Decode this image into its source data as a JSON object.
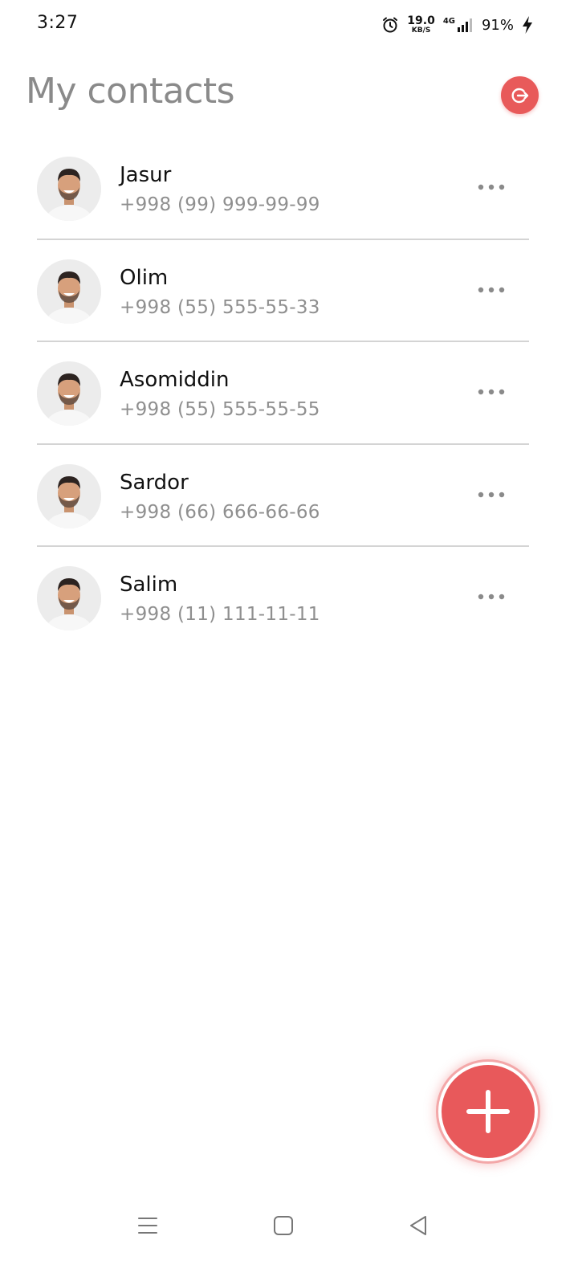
{
  "status_bar": {
    "time": "3:27",
    "net_speed_value": "19.0",
    "net_speed_unit": "KB/S",
    "network_type": "4G",
    "battery": "91%"
  },
  "header": {
    "title": "My contacts",
    "logout_icon": "logout-icon"
  },
  "contacts": [
    {
      "name": "Jasur",
      "phone": "+998 (99) 999-99-99"
    },
    {
      "name": "Olim",
      "phone": "+998 (55) 555-55-33"
    },
    {
      "name": "Asomiddin",
      "phone": "+998 (55) 555-55-55"
    },
    {
      "name": "Sardor",
      "phone": "+998 (66) 666-66-66"
    },
    {
      "name": "Salim",
      "phone": "+998 (11) 111-11-11"
    }
  ],
  "fab": {
    "icon": "plus-icon"
  },
  "nav": {
    "menu_icon": "menu-icon",
    "home_icon": "home-icon",
    "back_icon": "back-icon"
  },
  "colors": {
    "accent": "#e85a5a",
    "title": "#8a8a8a",
    "phone": "#8f8f8f",
    "divider": "#d4d4d4"
  }
}
